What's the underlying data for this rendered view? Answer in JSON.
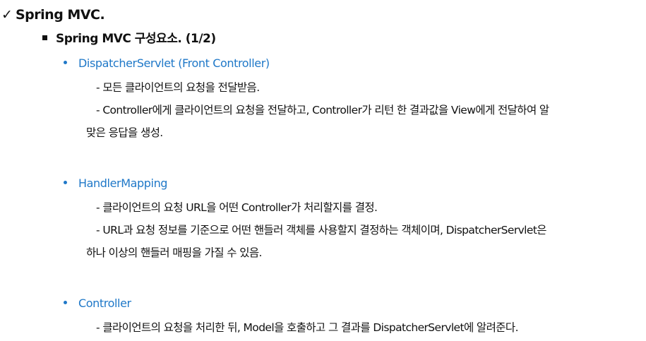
{
  "heading": {
    "marker": "✓",
    "title": "Spring MVC."
  },
  "subheading": {
    "title": "Spring MVC 구성요소. (1/2)"
  },
  "sections": [
    {
      "title": "DispatcherServlet (Front Controller)",
      "lines": [
        "- 모든 클라이언트의 요청을 전달받음.",
        "- Controller에게 클라이언트의 요청을 전달하고, Controller가 리턴 한 결과값을 View에게 전달하여 알",
        "맞은 응답을 생성."
      ]
    },
    {
      "title": "HandlerMapping",
      "lines": [
        "- 클라이언트의 요청 URL을 어떤 Controller가 처리할지를 결정.",
        "- URL과 요청 정보를 기준으로 어떤 핸들러 객체를 사용할지 결정하는 객체이며, DispatcherServlet은",
        "하나 이상의 핸들러 매핑을 가질 수 있음."
      ]
    },
    {
      "title": "Controller",
      "lines": [
        "- 클라이언트의 요청을 처리한 뒤, Model을 호출하고 그 결과를 DispatcherServlet에 알려준다."
      ]
    }
  ],
  "colors": {
    "text": "#111111",
    "accent": "#1f78c8"
  }
}
